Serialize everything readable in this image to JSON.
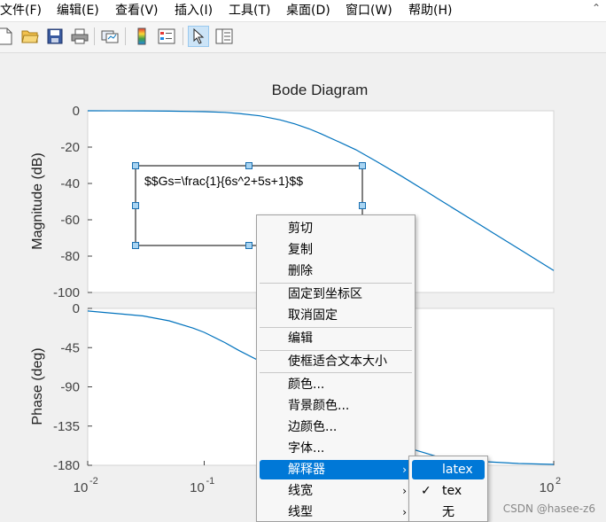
{
  "menubar": {
    "items": [
      "文件(F)",
      "编辑(E)",
      "查看(V)",
      "插入(I)",
      "工具(T)",
      "桌面(D)",
      "窗口(W)",
      "帮助(H)"
    ],
    "collapse_icon": "chevron-up-icon"
  },
  "toolbar": {
    "buttons": [
      "new-file-icon",
      "open-folder-icon",
      "save-icon",
      "print-icon",
      "link-plot-icon",
      "insert-colorbar-icon",
      "insert-legend-icon",
      "edit-plot-arrow-icon",
      "property-inspector-icon"
    ]
  },
  "chart_data": [
    {
      "type": "line",
      "title": "Bode Diagram",
      "ylabel": "Magnitude (dB)",
      "xscale": "log",
      "xlim": [
        0.01,
        100
      ],
      "ylim": [
        -100,
        0
      ],
      "yticks": [
        "0",
        "-20",
        "-40",
        "-60",
        "-80",
        "-100"
      ],
      "grid": false,
      "series": [
        {
          "x": [
            0.01,
            0.03,
            0.05,
            0.08,
            0.1,
            0.15,
            0.2,
            0.3,
            0.45,
            0.6,
            0.8,
            1,
            1.5,
            2,
            3,
            5,
            8,
            10,
            20,
            30,
            50,
            100
          ],
          "values": [
            0,
            -0.05,
            -0.2,
            -0.4,
            -0.5,
            -0.9,
            -1.5,
            -2.8,
            -5,
            -7.2,
            -10,
            -12.6,
            -17.7,
            -21.4,
            -27.8,
            -36.2,
            -44.3,
            -48.2,
            -60.1,
            -67.1,
            -75.9,
            -87.9
          ],
          "color": "#0072bd"
        }
      ]
    },
    {
      "type": "line",
      "ylabel": "Phase (deg)",
      "xscale": "log",
      "xlim": [
        0.01,
        100
      ],
      "ylim": [
        -180,
        0
      ],
      "yticks": [
        "0",
        "-45",
        "-90",
        "-135",
        "-180"
      ],
      "xticks": [
        "10",
        "10",
        "10"
      ],
      "xtick_exponents": [
        "-2",
        "-1",
        "2"
      ],
      "grid": false,
      "series": [
        {
          "x": [
            0.01,
            0.03,
            0.05,
            0.08,
            0.1,
            0.15,
            0.2,
            0.3,
            0.5,
            0.8,
            1,
            2,
            5,
            10,
            20,
            50,
            100
          ],
          "values": [
            -2.9,
            -8.6,
            -14.2,
            -22.6,
            -27.5,
            -39.2,
            -48.5,
            -60.5,
            -93,
            -108,
            -117,
            -140,
            -158,
            -170,
            -175,
            -178,
            -179
          ],
          "color": "#0072bd"
        }
      ]
    }
  ],
  "annotation": {
    "text": "$$Gs=\\frac{1}{6s^2+5s+1}$$"
  },
  "context_menu": {
    "items": [
      "剪切",
      "复制",
      "删除",
      "固定到坐标区",
      "取消固定",
      "编辑",
      "使框适合文本大小",
      "颜色...",
      "背景颜色...",
      "边颜色...",
      "字体...",
      "解释器",
      "线宽",
      "线型"
    ],
    "highlighted": "解释器"
  },
  "submenu": {
    "items": [
      "latex",
      "tex",
      "无"
    ],
    "highlighted": "latex",
    "checked": "tex"
  },
  "watermark": "CSDN @hasee-z6"
}
